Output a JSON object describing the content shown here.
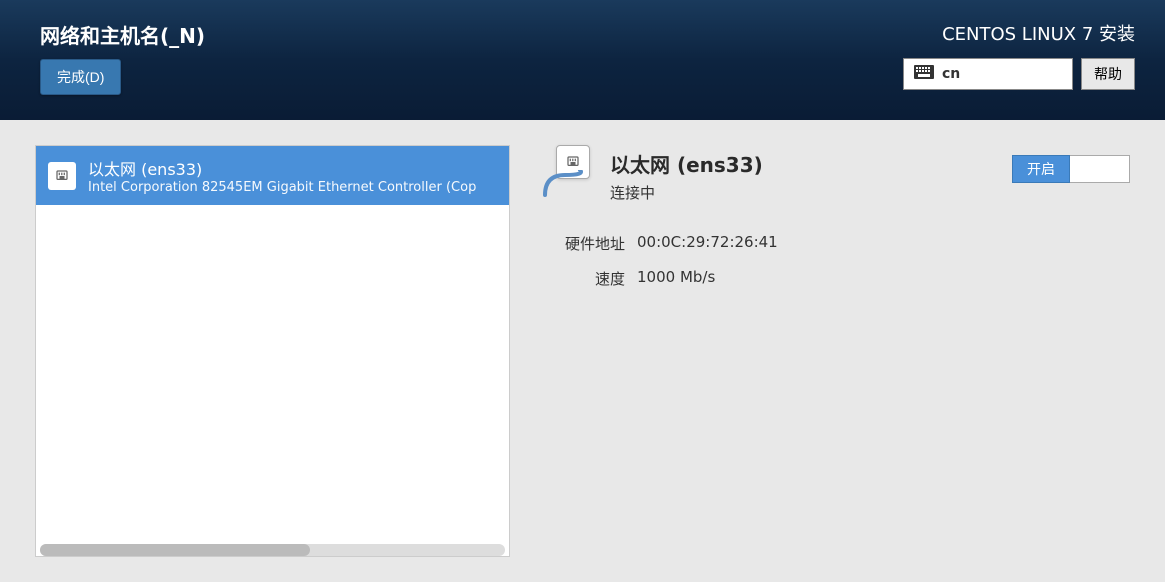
{
  "header": {
    "page_title": "网络和主机名(_N)",
    "done_button": "完成(D)",
    "install_title": "CENTOS LINUX 7 安装",
    "lang_code": "cn",
    "help_button": "帮助"
  },
  "device_list": {
    "items": [
      {
        "name": "以太网 (ens33)",
        "description": "Intel Corporation 82545EM Gigabit Ethernet Controller (Cop"
      }
    ]
  },
  "detail": {
    "name": "以太网 (ens33)",
    "status": "连接中",
    "hw_label": "硬件地址",
    "hw_value": "00:0C:29:72:26:41",
    "speed_label": "速度",
    "speed_value": "1000 Mb/s",
    "toggle_label": "开启"
  }
}
